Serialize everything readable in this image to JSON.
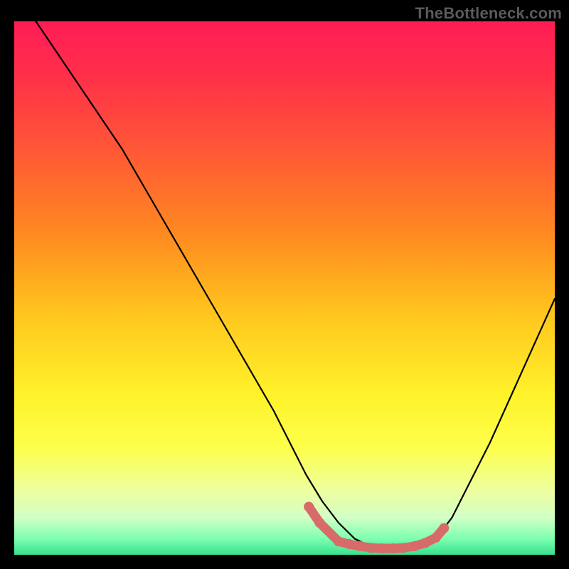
{
  "watermark": "TheBottleneck.com",
  "colors": {
    "background": "#000000",
    "gradient_stops": [
      {
        "offset": 0.0,
        "color": "#ff1c55"
      },
      {
        "offset": 0.1,
        "color": "#ff2f4a"
      },
      {
        "offset": 0.25,
        "color": "#ff5a35"
      },
      {
        "offset": 0.4,
        "color": "#ff8a20"
      },
      {
        "offset": 0.55,
        "color": "#ffc61e"
      },
      {
        "offset": 0.7,
        "color": "#fff22a"
      },
      {
        "offset": 0.8,
        "color": "#fdff4b"
      },
      {
        "offset": 0.88,
        "color": "#edffa0"
      },
      {
        "offset": 0.93,
        "color": "#d2ffc6"
      },
      {
        "offset": 0.97,
        "color": "#7dffb0"
      },
      {
        "offset": 1.0,
        "color": "#37e08f"
      }
    ],
    "curve": "#000000",
    "marker_fill": "#d96a6a",
    "marker_stroke": "#d96a6a"
  },
  "chart_data": {
    "type": "line",
    "title": "",
    "xlabel": "",
    "ylabel": "",
    "xlim": [
      0,
      100
    ],
    "ylim": [
      0,
      100
    ],
    "grid": false,
    "series": [
      {
        "name": "bottleneck-curve",
        "x": [
          4,
          8,
          12,
          16,
          20,
          24,
          28,
          32,
          36,
          40,
          44,
          48,
          51,
          54,
          57,
          60,
          63,
          66,
          69,
          72,
          75,
          78,
          81,
          84,
          88,
          92,
          96,
          100
        ],
        "y": [
          100,
          94,
          88,
          82,
          76,
          69,
          62,
          55,
          48,
          41,
          34,
          27,
          21,
          15,
          10,
          6,
          3,
          1.5,
          1,
          1,
          1.5,
          3,
          7,
          13,
          21,
          30,
          39,
          48
        ]
      }
    ],
    "highlight_points": {
      "name": "optimal-range-markers",
      "x": [
        54.5,
        56.5,
        60,
        62,
        64,
        66,
        68,
        70,
        72,
        74,
        76,
        78,
        79.5
      ],
      "y": [
        9,
        6,
        2.5,
        2,
        1.6,
        1.3,
        1.2,
        1.2,
        1.3,
        1.6,
        2.2,
        3.2,
        5
      ],
      "radius": 7
    }
  }
}
